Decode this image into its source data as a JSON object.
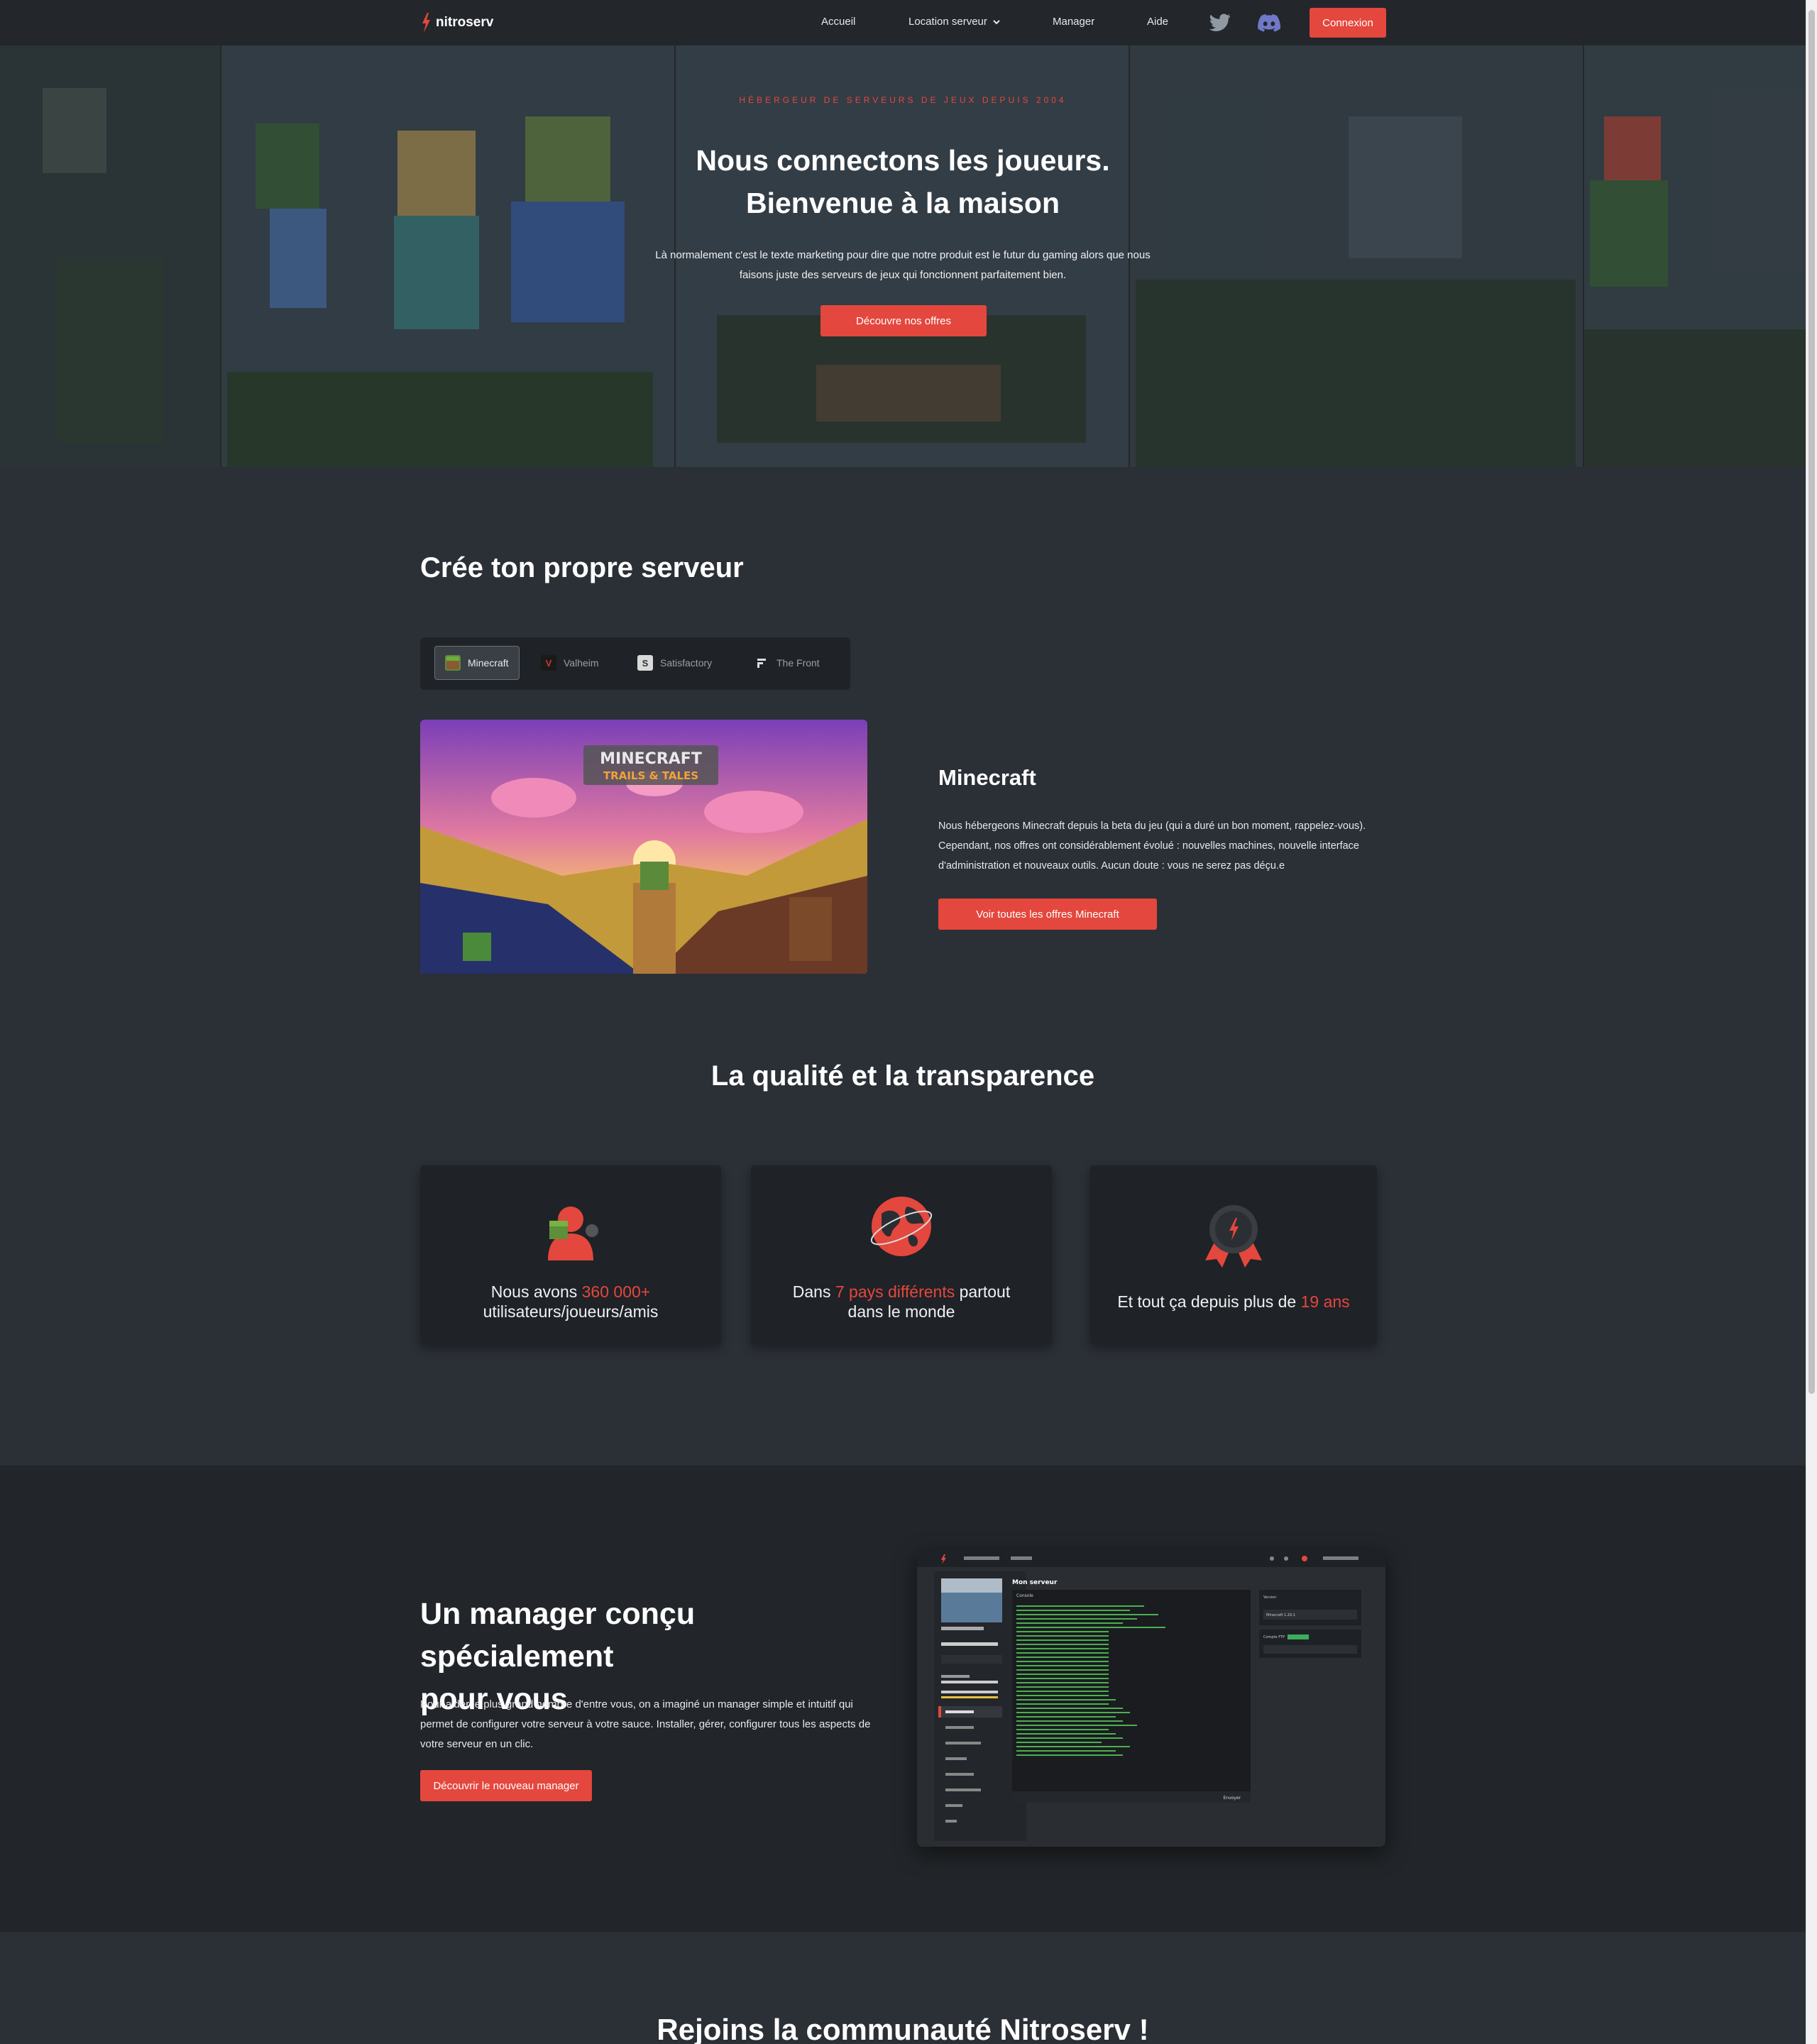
{
  "nav": {
    "logo_text": "nitroserv",
    "items": [
      "Accueil",
      "Location serveur",
      "Manager",
      "Aide"
    ],
    "login": "Connexion",
    "icons": [
      "twitter-icon",
      "discord-icon"
    ]
  },
  "hero": {
    "eyebrow": "HÉBERGEUR DE SERVEURS DE JEUX DEPUIS 2004",
    "title_line1": "Nous connectons les joueurs.",
    "title_line2": "Bienvenue à la maison",
    "subtitle_line1": "Là normalement c'est le texte marketing pour dire que notre produit est le futur du gaming alors que nous",
    "subtitle_line2": "faisons juste des serveurs de jeux qui fonctionnent parfaitement bien.",
    "cta": "Découvre nos offres"
  },
  "create": {
    "title": "Crée ton propre serveur",
    "tabs": [
      "Minecraft",
      "Valheim",
      "Satisfactory",
      "The Front"
    ],
    "active_tab": "Minecraft",
    "game_image_logo_line1": "MINECRAFT",
    "game_image_logo_line2": "TRAILS & TALES",
    "game_title": "Minecraft",
    "game_desc": "Nous hébergeons Minecraft depuis la beta du jeu (qui a duré un bon moment, rappelez-vous). Cependant, nos offres ont considérablement évolué : nouvelles machines, nouvelle interface d'administration et nouveaux outils. Aucun doute : vous ne serez pas déçu.e",
    "game_cta": "Voir toutes les offres Minecraft"
  },
  "quality": {
    "title": "La qualité et la transparence",
    "cards": [
      {
        "pre": "Nous avons ",
        "highlight": "360 000+",
        "post": "utilisateurs/joueurs/amis"
      },
      {
        "pre": "Dans ",
        "highlight": "7 pays différents",
        "post_same": " partout",
        "post": "dans le monde"
      },
      {
        "pre": "Et tout ça depuis plus de ",
        "highlight": "19 ans"
      }
    ]
  },
  "manager": {
    "title_line1": "Un manager conçu spécialement",
    "title_line2": "pour vous",
    "desc": "Pour aider le plus grand nombre d'entre vous, on a imaginé un manager simple et intuitif qui permet de configurer votre serveur à votre sauce. Installer, gérer, configurer tous les aspects de votre serveur en un clic.",
    "cta": "Découvrir le nouveau manager",
    "screenshot": {
      "page_title": "Mon serveur",
      "console_label": "Console",
      "version_label": "Version",
      "version_value": "Minecraft 1.20.1",
      "ftp_label": "Compte FTP",
      "send": "Envoyer"
    }
  },
  "community": {
    "title": "Rejoins la communauté Nitroserv !"
  },
  "colors": {
    "accent": "#e4473d",
    "nav_bg": "#23262b",
    "section_bg": "#2b2f36",
    "card_bg": "#1f2227"
  }
}
